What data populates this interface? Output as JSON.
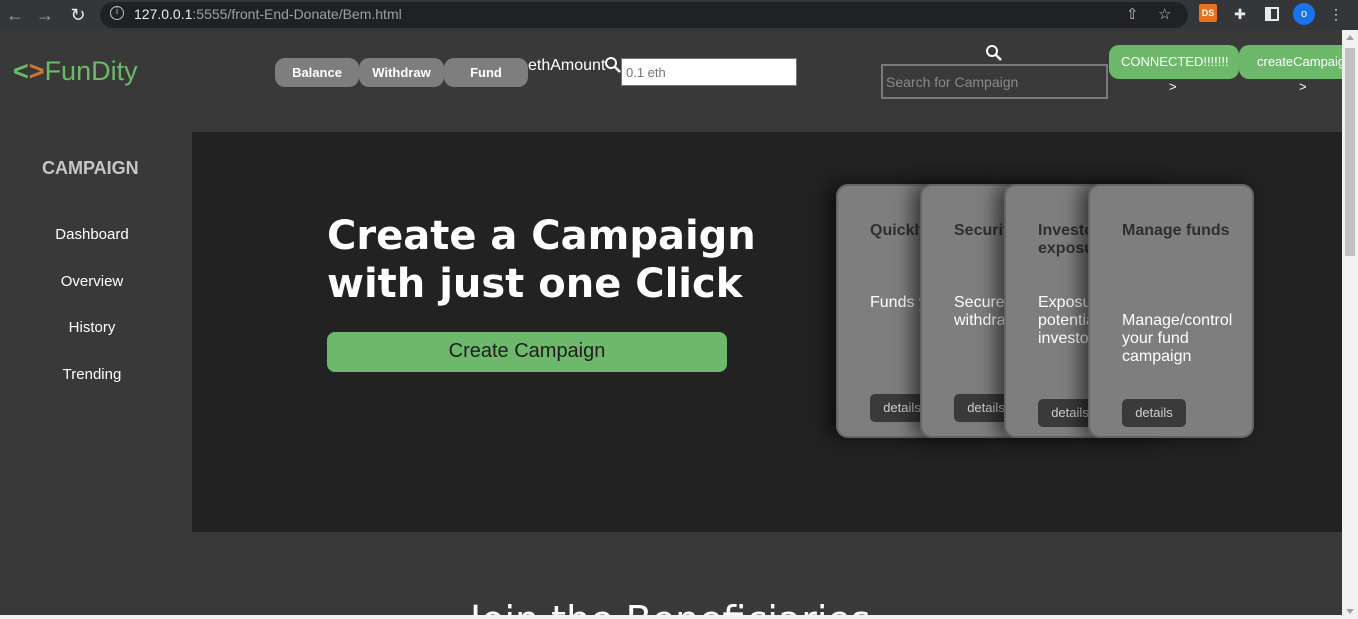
{
  "browser": {
    "url_host": "127.0.0.1",
    "url_rest": ":5555/front-End-Donate/Bem.html",
    "extension_ds": "DS",
    "profile_initial": "o"
  },
  "header": {
    "logo_lt": "<",
    "logo_gt": ">",
    "logo_name": "FunDity",
    "balance_label": "Balance",
    "withdraw_label": "Withdraw",
    "fund_label": "Fund",
    "eth_label": "ethAmount",
    "eth_placeholder": "0.1 eth",
    "search_placeholder": "Search for Campaign",
    "connected_label": "CONNECTED!!!!!!!",
    "create_campaign_btn": "createCampaign",
    "arrow": ">"
  },
  "sidebar": {
    "title": "CAMPAIGN",
    "items": [
      {
        "label": "Dashboard"
      },
      {
        "label": "Overview"
      },
      {
        "label": "History"
      },
      {
        "label": "Trending"
      }
    ]
  },
  "hero": {
    "title_line1": "Create a Campaign",
    "title_line2": "with just one Click",
    "button_label": "Create Campaign"
  },
  "cards": [
    {
      "title": "Quickly",
      "body": "Funds your pr",
      "button": "details"
    },
    {
      "title": "Security",
      "body": "Secure creation withdra",
      "button": "details"
    },
    {
      "title": "Investor exposure",
      "body": "Exposure potential investor",
      "button": "details"
    },
    {
      "title": "Manage funds",
      "body": "Manage/control your fund campaign",
      "button": "details"
    }
  ],
  "bottom_heading": "Join the Beneficiaries"
}
